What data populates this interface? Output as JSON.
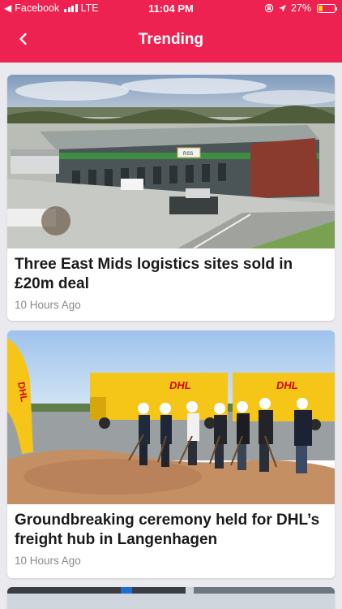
{
  "status_bar": {
    "back_app": "Facebook",
    "network": "LTE",
    "time": "11:04 PM",
    "battery": "27%",
    "battery_level": 0.27,
    "colors": {
      "bar": "#ee2250",
      "battery_fill": "#ffd21a"
    }
  },
  "nav": {
    "title": "Trending",
    "back_icon": "chevron-left-icon",
    "color": "#ee2250"
  },
  "articles": [
    {
      "title": "Three East Mids logistics sites sold in £20m deal",
      "time": "10 Hours Ago",
      "image": "aerial-warehouse-photo",
      "image_sign": "RSS"
    },
    {
      "title": "Groundbreaking ceremony held for DHL’s freight hub in Langenhagen",
      "time": "10 Hours Ago",
      "image": "dhl-ceremony-photo",
      "image_text": "DHL"
    }
  ]
}
